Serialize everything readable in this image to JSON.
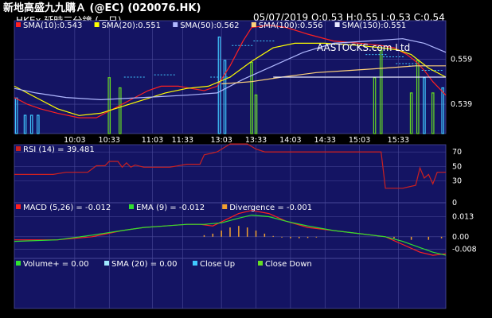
{
  "header": {
    "title": "新地高盛九九購Ａ (@EC) (020076.HK)",
    "subtitle": "HKEx 延時三分鐘 (一日)",
    "watermark": "AASTOCKS.com Ltd",
    "ohlc": "05/07/2019  O:0.53  H:0.55  L:0.53  C:0.54"
  },
  "colors": {
    "panel_bg": "#141463",
    "grid": "#4a4a9a",
    "sma10": "#ff2020",
    "sma20": "#ffff00",
    "sma50": "#b0b8ff",
    "sma100": "#ffd27a",
    "sma150": "#e8e8ff",
    "rsi": "#cc2020",
    "macd": "#ff2020",
    "ema": "#30e030",
    "divergence": "#f0a030",
    "volume": "#30e030",
    "close_up": "#40c8ff",
    "close_down": "#66dd22"
  },
  "chart_data": [
    {
      "type": "line",
      "name": "price",
      "legend": [
        {
          "label": "SMA(10):0.543",
          "color": "#ff2020"
        },
        {
          "label": "SMA(20):0.551",
          "color": "#ffff00"
        },
        {
          "label": "SMA(50):0.562",
          "color": "#b0b8ff"
        },
        {
          "label": "SMA(100):0.556",
          "color": "#ffd27a"
        },
        {
          "label": "SMA(150):0.551",
          "color": "#e8e8ff"
        }
      ],
      "x_ticks": [
        "10:03",
        "10:33",
        "11:03",
        "11:33",
        "13:03",
        "13:33",
        "14:03",
        "14:33",
        "15:03",
        "15:33"
      ],
      "y_ticks": [
        0.559,
        0.539
      ],
      "ylim": [
        0.526,
        0.576
      ],
      "xlim": [
        0,
        100
      ],
      "series": [
        {
          "key": "sma10",
          "points": [
            [
              0,
              0.542
            ],
            [
              3,
              0.539
            ],
            [
              6,
              0.537
            ],
            [
              10,
              0.535
            ],
            [
              15,
              0.533
            ],
            [
              19,
              0.533
            ],
            [
              22,
              0.536
            ],
            [
              27,
              0.541
            ],
            [
              31,
              0.545
            ],
            [
              34,
              0.547
            ],
            [
              38,
              0.547
            ],
            [
              41,
              0.546
            ],
            [
              44,
              0.545
            ],
            [
              47,
              0.547
            ],
            [
              50,
              0.556
            ],
            [
              53,
              0.567
            ],
            [
              55,
              0.573
            ],
            [
              59,
              0.574
            ],
            [
              63,
              0.573
            ],
            [
              68,
              0.57
            ],
            [
              74,
              0.567
            ],
            [
              80,
              0.566
            ],
            [
              85,
              0.565
            ],
            [
              88,
              0.564
            ],
            [
              91,
              0.561
            ],
            [
              93,
              0.558
            ],
            [
              95,
              0.554
            ],
            [
              97,
              0.549
            ],
            [
              100,
              0.543
            ]
          ]
        },
        {
          "key": "sma20",
          "points": [
            [
              0,
              0.547
            ],
            [
              5,
              0.542
            ],
            [
              10,
              0.537
            ],
            [
              15,
              0.534
            ],
            [
              20,
              0.535
            ],
            [
              25,
              0.538
            ],
            [
              30,
              0.541
            ],
            [
              35,
              0.544
            ],
            [
              40,
              0.546
            ],
            [
              45,
              0.547
            ],
            [
              50,
              0.551
            ],
            [
              55,
              0.558
            ],
            [
              60,
              0.564
            ],
            [
              65,
              0.566
            ],
            [
              72,
              0.566
            ],
            [
              80,
              0.565
            ],
            [
              85,
              0.564
            ],
            [
              89,
              0.563
            ],
            [
              92,
              0.561
            ],
            [
              96,
              0.555
            ],
            [
              100,
              0.551
            ]
          ]
        },
        {
          "key": "sma50",
          "points": [
            [
              0,
              0.546
            ],
            [
              5,
              0.544
            ],
            [
              12,
              0.542
            ],
            [
              20,
              0.541
            ],
            [
              30,
              0.542
            ],
            [
              40,
              0.543
            ],
            [
              47,
              0.544
            ],
            [
              53,
              0.55
            ],
            [
              60,
              0.556
            ],
            [
              67,
              0.562
            ],
            [
              74,
              0.566
            ],
            [
              82,
              0.567
            ],
            [
              90,
              0.568
            ],
            [
              95,
              0.566
            ],
            [
              100,
              0.562
            ]
          ]
        },
        {
          "key": "sma100",
          "points": [
            [
              48,
              0.548
            ],
            [
              55,
              0.549
            ],
            [
              62,
              0.551
            ],
            [
              70,
              0.553
            ],
            [
              78,
              0.554
            ],
            [
              86,
              0.555
            ],
            [
              93,
              0.556
            ],
            [
              100,
              0.556
            ]
          ]
        },
        {
          "key": "sma150",
          "points": [
            [
              60,
              0.551
            ],
            [
              70,
              0.551
            ],
            [
              80,
              0.551
            ],
            [
              90,
              0.551
            ],
            [
              100,
              0.551
            ]
          ]
        }
      ],
      "ticks_dashed": [
        [
          28,
          0.551
        ],
        [
          35,
          0.552
        ],
        [
          48,
          0.551
        ],
        [
          53,
          0.565
        ],
        [
          58,
          0.567
        ],
        [
          84,
          0.561
        ],
        [
          88,
          0.56
        ],
        [
          91,
          0.557
        ],
        [
          94,
          0.556
        ],
        [
          97,
          0.554
        ]
      ],
      "volume_bars": [
        {
          "x": 0.5,
          "h": 0.35,
          "c": "close_up"
        },
        {
          "x": 2.5,
          "h": 0.18,
          "c": "close_up"
        },
        {
          "x": 4.0,
          "h": 0.18,
          "c": "close_up"
        },
        {
          "x": 5.5,
          "h": 0.18,
          "c": "close_up"
        },
        {
          "x": 22.0,
          "h": 0.55,
          "c": "close_down"
        },
        {
          "x": 24.5,
          "h": 0.45,
          "c": "close_down"
        },
        {
          "x": 47.5,
          "h": 0.95,
          "c": "close_up"
        },
        {
          "x": 48.8,
          "h": 0.72,
          "c": "close_up"
        },
        {
          "x": 55.0,
          "h": 0.7,
          "c": "close_down"
        },
        {
          "x": 56.0,
          "h": 0.38,
          "c": "close_down"
        },
        {
          "x": 83.5,
          "h": 0.55,
          "c": "close_down"
        },
        {
          "x": 85.0,
          "h": 0.82,
          "c": "close_down"
        },
        {
          "x": 92.0,
          "h": 0.4,
          "c": "close_down"
        },
        {
          "x": 93.5,
          "h": 0.72,
          "c": "close_down"
        },
        {
          "x": 95.0,
          "h": 0.55,
          "c": "close_up"
        },
        {
          "x": 97.0,
          "h": 0.4,
          "c": "close_down"
        },
        {
          "x": 99.3,
          "h": 0.45,
          "c": "close_up"
        }
      ]
    },
    {
      "type": "line",
      "name": "rsi",
      "legend": [
        {
          "label": "RSI (14) = 39.481",
          "color": "#cc2020"
        }
      ],
      "y_ticks": [
        70,
        50,
        30,
        0
      ],
      "ylim": [
        0,
        80
      ],
      "series": [
        {
          "key": "rsi",
          "points": [
            [
              0,
              39
            ],
            [
              9,
              39
            ],
            [
              12,
              42
            ],
            [
              17,
              42
            ],
            [
              19,
              51
            ],
            [
              21,
              51
            ],
            [
              22,
              57
            ],
            [
              24,
              57
            ],
            [
              25,
              49
            ],
            [
              26,
              55
            ],
            [
              27,
              49
            ],
            [
              28,
              52
            ],
            [
              30,
              49
            ],
            [
              36,
              49
            ],
            [
              40,
              53
            ],
            [
              43,
              53
            ],
            [
              44,
              66
            ],
            [
              47,
              70
            ],
            [
              50,
              81
            ],
            [
              54,
              81
            ],
            [
              56,
              74
            ],
            [
              58,
              70
            ],
            [
              62,
              70
            ],
            [
              70,
              70
            ],
            [
              80,
              70
            ],
            [
              85,
              70
            ],
            [
              86,
              20
            ],
            [
              90,
              20
            ],
            [
              93,
              24
            ],
            [
              94,
              48
            ],
            [
              95,
              34
            ],
            [
              96,
              39
            ],
            [
              97,
              26
            ],
            [
              98,
              42
            ],
            [
              100,
              42
            ]
          ]
        }
      ]
    },
    {
      "type": "line",
      "name": "macd",
      "legend": [
        {
          "label": "MACD (5,26) = -0.012",
          "color": "#ff2020"
        },
        {
          "label": "EMA (9) = -0.012",
          "color": "#30e030"
        },
        {
          "label": "Divergence = -0.001",
          "color": "#f0a030"
        }
      ],
      "y_ticks": [
        0.013,
        0.0,
        -0.008
      ],
      "ylim": [
        -0.014,
        0.022
      ],
      "series": [
        {
          "key": "macd",
          "points": [
            [
              0,
              -0.002
            ],
            [
              10,
              -0.002
            ],
            [
              18,
              0.0
            ],
            [
              25,
              0.004
            ],
            [
              30,
              0.006
            ],
            [
              35,
              0.007
            ],
            [
              40,
              0.008
            ],
            [
              43,
              0.008
            ],
            [
              46,
              0.007
            ],
            [
              49,
              0.011
            ],
            [
              52,
              0.015
            ],
            [
              55,
              0.017
            ],
            [
              59,
              0.015
            ],
            [
              63,
              0.01
            ],
            [
              68,
              0.006
            ],
            [
              74,
              0.004
            ],
            [
              80,
              0.002
            ],
            [
              86,
              0.0
            ],
            [
              90,
              -0.005
            ],
            [
              94,
              -0.01
            ],
            [
              97,
              -0.012
            ],
            [
              100,
              -0.011
            ]
          ]
        },
        {
          "key": "ema",
          "points": [
            [
              0,
              -0.003
            ],
            [
              10,
              -0.002
            ],
            [
              18,
              0.001
            ],
            [
              25,
              0.004
            ],
            [
              30,
              0.006
            ],
            [
              35,
              0.007
            ],
            [
              40,
              0.008
            ],
            [
              44,
              0.008
            ],
            [
              48,
              0.009
            ],
            [
              52,
              0.012
            ],
            [
              55,
              0.014
            ],
            [
              59,
              0.013
            ],
            [
              63,
              0.01
            ],
            [
              68,
              0.007
            ],
            [
              74,
              0.004
            ],
            [
              80,
              0.002
            ],
            [
              86,
              0.0
            ],
            [
              90,
              -0.003
            ],
            [
              94,
              -0.007
            ],
            [
              97,
              -0.01
            ],
            [
              100,
              -0.012
            ]
          ]
        }
      ],
      "divergence_bars": [
        [
          44,
          0.001
        ],
        [
          46,
          0.002
        ],
        [
          48,
          0.004
        ],
        [
          50,
          0.006
        ],
        [
          52,
          0.007
        ],
        [
          54,
          0.006
        ],
        [
          56,
          0.004
        ],
        [
          58,
          0.002
        ],
        [
          60,
          0.0005
        ],
        [
          62,
          -0.0005
        ],
        [
          64,
          -0.001
        ],
        [
          66,
          -0.001
        ],
        [
          68,
          -0.0008
        ],
        [
          70,
          -0.0005
        ],
        [
          88,
          -0.001
        ],
        [
          92,
          -0.002
        ],
        [
          96,
          -0.002
        ],
        [
          99,
          -0.001
        ]
      ]
    },
    {
      "type": "bar",
      "name": "volume",
      "legend": [
        {
          "label": "Volume+  = 0.00",
          "color": "#30e030"
        },
        {
          "label": "SMA (20) = 0.00",
          "color": "#a0e8ff"
        },
        {
          "label": "Close Up",
          "color": "#40c8ff"
        },
        {
          "label": "Close Down",
          "color": "#66dd22"
        }
      ],
      "values": []
    }
  ]
}
